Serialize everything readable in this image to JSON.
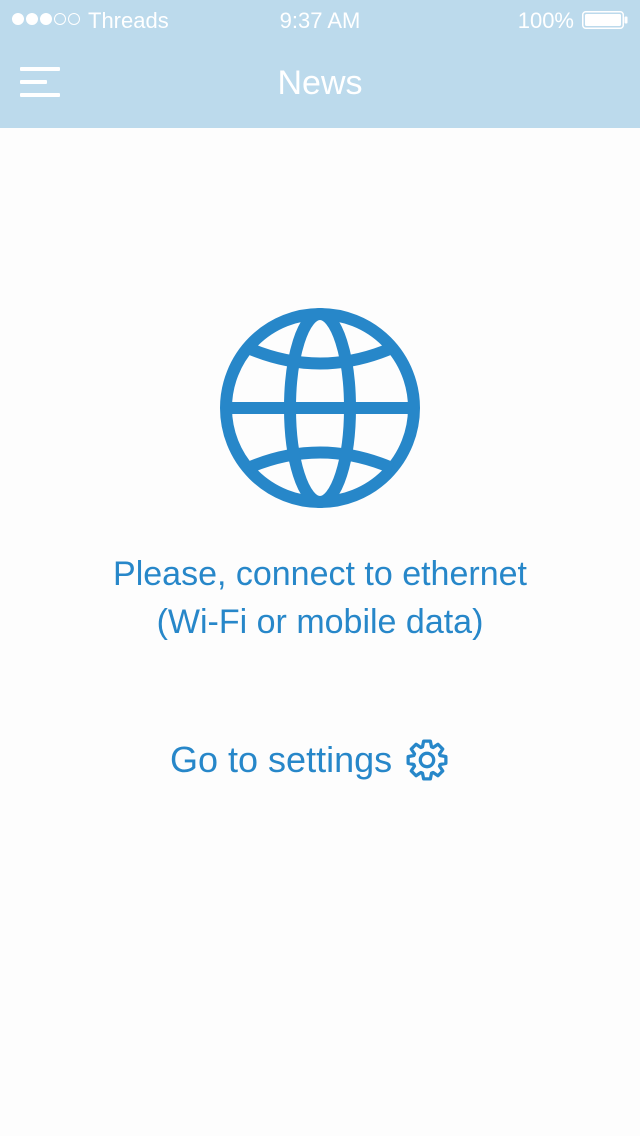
{
  "status_bar": {
    "signal_dots": 5,
    "signal_filled": 3,
    "carrier": "Threads",
    "time": "9:37 AM",
    "battery_percent": "100%",
    "battery_level": 1.0
  },
  "navbar": {
    "title": "News",
    "menu_icon": "hamburger-menu-icon"
  },
  "empty_state": {
    "icon": "globe-icon",
    "message_line1": "Please, connect to ethernet",
    "message_line2": "(Wi-Fi or mobile data)",
    "settings_label": "Go to settings",
    "settings_icon": "gear-icon"
  },
  "colors": {
    "header_bg": "#bcdaec",
    "accent": "#2787c9",
    "background": "#fdfdfd"
  }
}
